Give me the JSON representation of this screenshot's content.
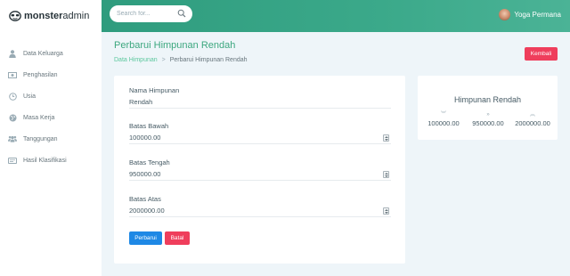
{
  "brand": {
    "strong": "monster",
    "light": "admin"
  },
  "search": {
    "placeholder": "Search for..."
  },
  "user": {
    "name": "Yoga Permana"
  },
  "sidebar": {
    "items": [
      {
        "label": "Data Keluarga",
        "icon": "user-icon"
      },
      {
        "label": "Penghasilan",
        "icon": "money-icon"
      },
      {
        "label": "Usia",
        "icon": "clock-icon"
      },
      {
        "label": "Masa Kerja",
        "icon": "globe-icon"
      },
      {
        "label": "Tanggungan",
        "icon": "users-icon"
      },
      {
        "label": "Hasil Klasifikasi",
        "icon": "card-icon"
      }
    ]
  },
  "page": {
    "title": "Perbarui Himpunan Rendah",
    "breadcrumb": {
      "link": "Data Himpunan",
      "separator": ">",
      "current": "Perbarui Himpunan Rendah"
    },
    "back_label": "Kembali"
  },
  "form": {
    "fields": [
      {
        "label": "Nama Himpunan",
        "value": "Rendah",
        "type": "text"
      },
      {
        "label": "Batas Bawah",
        "value": "100000.00",
        "type": "number"
      },
      {
        "label": "Batas Tengah",
        "value": "950000.00",
        "type": "number"
      },
      {
        "label": "Batas Atas",
        "value": "2000000.00",
        "type": "number"
      }
    ],
    "submit_label": "Perbarui",
    "cancel_label": "Batal"
  },
  "summary": {
    "title": "Himpunan Rendah",
    "stats": [
      {
        "icon": "double-chevron-down-icon",
        "glyph": "︾",
        "value": "100000.00"
      },
      {
        "icon": "double-chevron-right-icon",
        "glyph": "»",
        "value": "950000.00"
      },
      {
        "icon": "double-chevron-up-icon",
        "glyph": "︽",
        "value": "2000000.00"
      }
    ]
  },
  "colors": {
    "header_gradient_start": "#2f9c7e",
    "header_gradient_end": "#4bb396",
    "accent_green": "#3ca77f",
    "primary_blue": "#1e88e5",
    "danger_red": "#ef3e5c",
    "background": "#eef5f9"
  }
}
